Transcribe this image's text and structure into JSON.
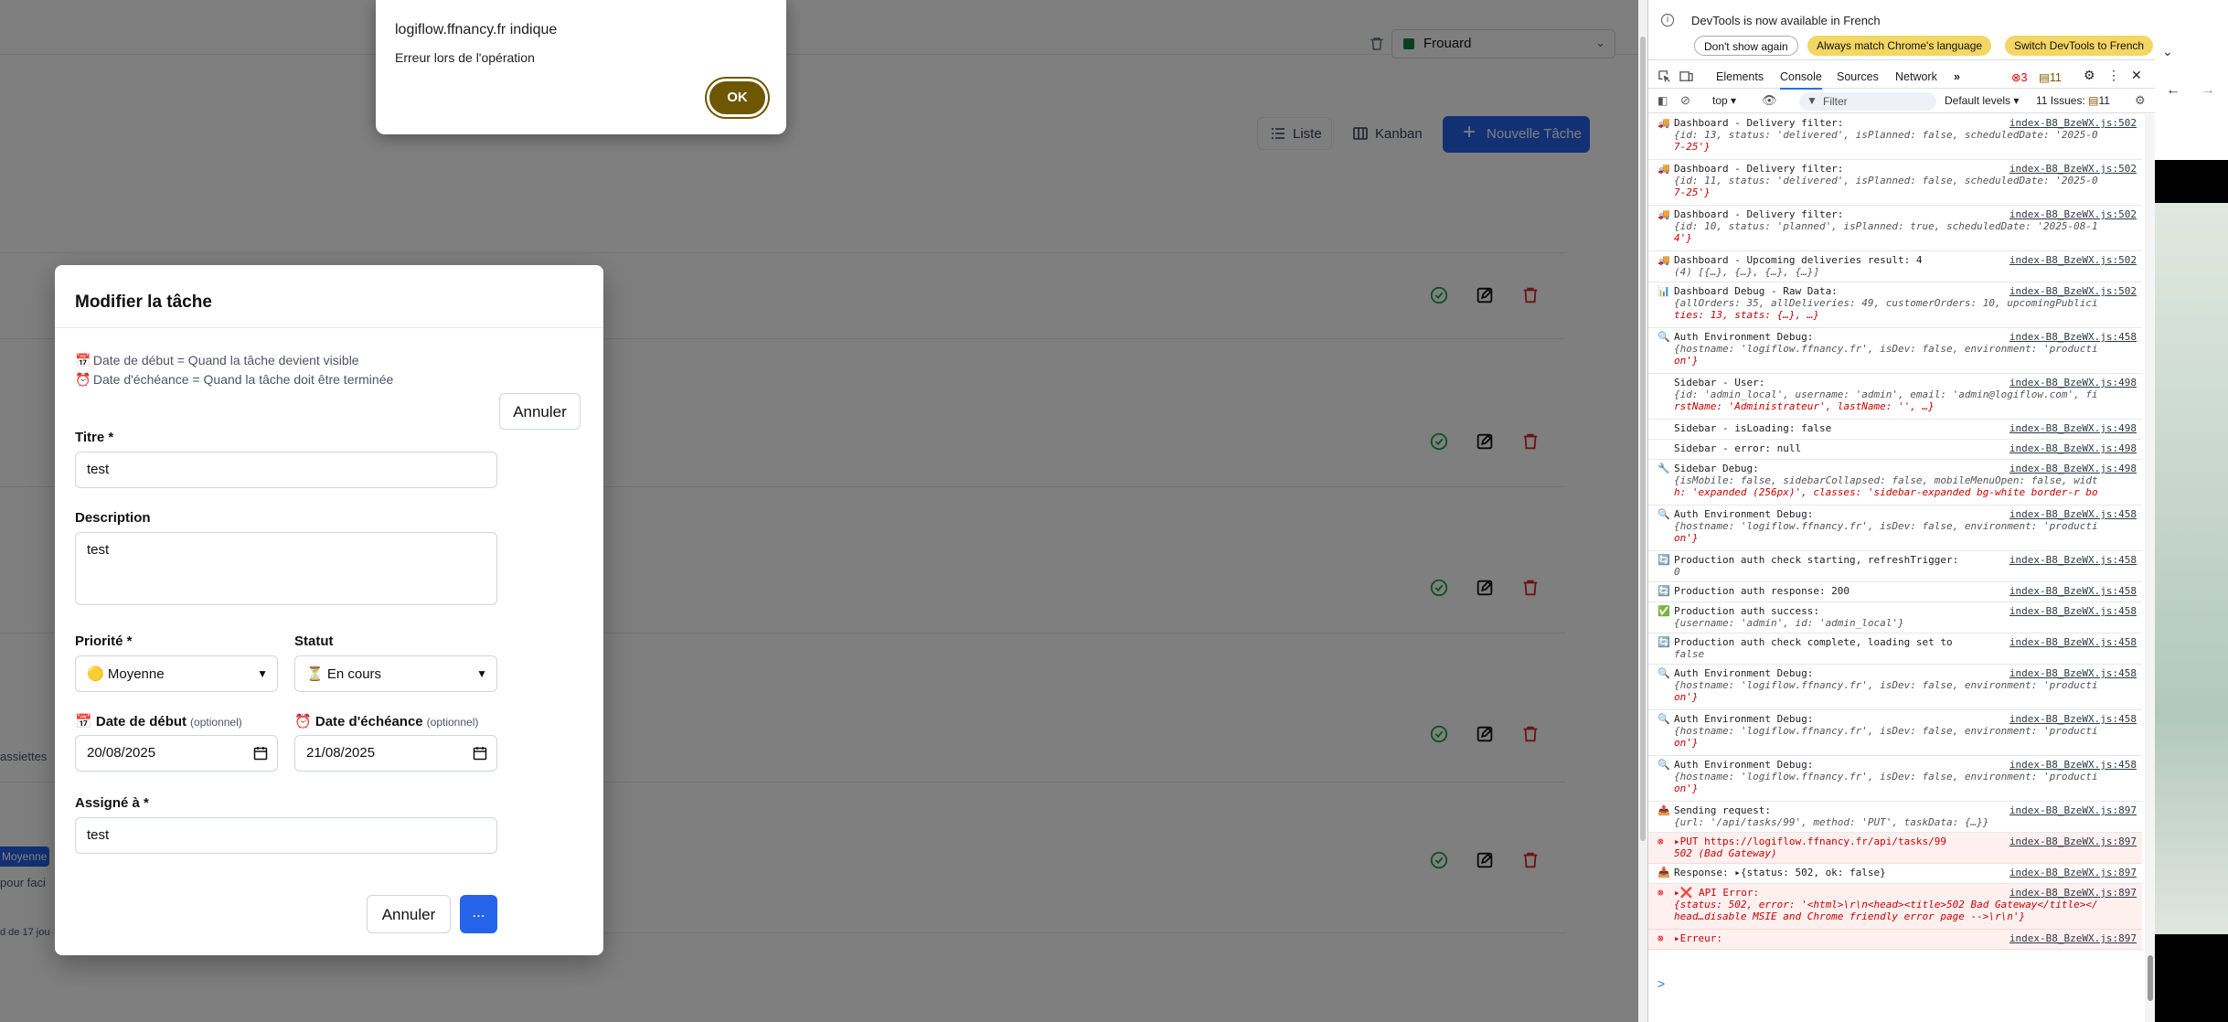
{
  "app": {
    "user_select_value": "Frouard",
    "view_list_label": "Liste",
    "view_kanban_label": "Kanban",
    "new_task_label": "Nouvelle Tâche",
    "snippet_1": "assiettes",
    "snippet_badge": "Moyenne",
    "snippet_2": "pour faci",
    "snippet_3": "d de 17 jou"
  },
  "alert": {
    "title": "logiflow.ffnancy.fr indique",
    "message": "Erreur lors de l'opération",
    "ok_label": "OK"
  },
  "modal": {
    "title": "Modifier la tâche",
    "hint_start": "Date de début = Quand la tâche devient visible",
    "hint_due": "Date d'échéance = Quand la tâche doit être terminée",
    "cancel_top_label": "Annuler",
    "title_label": "Titre *",
    "title_value": "test",
    "description_label": "Description",
    "description_value": "test",
    "priority_label": "Priorité *",
    "priority_value": "Moyenne",
    "status_label": "Statut",
    "status_value": "En cours",
    "start_label": "Date de début",
    "start_optional": "(optionnel)",
    "start_value": "20/08/2025",
    "due_label": "Date d'échéance",
    "due_optional": "(optionnel)",
    "due_value": "21/08/2025",
    "assigned_label": "Assigné à *",
    "assigned_value": "test",
    "cancel_label": "Annuler",
    "save_label": "..."
  },
  "devtools": {
    "info_text": "DevTools is now available in French",
    "btn_dont_show": "Don't show again",
    "btn_match": "Always match Chrome's language",
    "btn_switch": "Switch DevTools to French",
    "tabs": [
      "Elements",
      "Console",
      "Sources",
      "Network"
    ],
    "error_count": "3",
    "warn_count": "11",
    "context": "top",
    "filter_placeholder": "Filter",
    "levels": "Default levels",
    "issues": "11 Issues:",
    "issues_count": "11",
    "logs": [
      {
        "icon": "🚚",
        "msg": "Dashboard - Delivery filter:",
        "src": "index-B8_BzeWX.js:502",
        "sub": "{id: 13, status: 'delivered', isPlanned: false, scheduledDate: '2025-0",
        "sub2": "7-25'}"
      },
      {
        "icon": "🚚",
        "msg": "Dashboard - Delivery filter:",
        "src": "index-B8_BzeWX.js:502",
        "sub": "{id: 11, status: 'delivered', isPlanned: false, scheduledDate: '2025-0",
        "sub2": "7-25'}"
      },
      {
        "icon": "🚚",
        "msg": "Dashboard - Delivery filter:",
        "src": "index-B8_BzeWX.js:502",
        "sub": "{id: 10, status: 'planned', isPlanned: true, scheduledDate: '2025-08-1",
        "sub2": "4'}"
      },
      {
        "icon": "🚚",
        "msg": "Dashboard - Upcoming deliveries result: 4",
        "src": "index-B8_BzeWX.js:502",
        "sub": "(4) [{…}, {…}, {…}, {…}]",
        "sub2": ""
      },
      {
        "icon": "📊",
        "msg": "Dashboard Debug - Raw Data:",
        "src": "index-B8_BzeWX.js:502",
        "sub": "{allOrders: 35, allDeliveries: 49, customerOrders: 10, upcomingPublici",
        "sub2": "ties: 13, stats: {…}, …}"
      },
      {
        "icon": "🔍",
        "msg": "Auth Environment Debug:",
        "src": "index-B8_BzeWX.js:458",
        "sub": "{hostname: 'logiflow.ffnancy.fr', isDev: false, environment: 'producti",
        "sub2": "on'}"
      },
      {
        "icon": "",
        "msg": "Sidebar - User:",
        "src": "index-B8_BzeWX.js:498",
        "sub": "{id: 'admin_local', username: 'admin', email: 'admin@logiflow.com', fi",
        "sub2": "rstName: 'Administrateur', lastName: '', …}"
      },
      {
        "icon": "",
        "msg": "Sidebar - isLoading: false",
        "src": "index-B8_BzeWX.js:498",
        "sub": "",
        "sub2": ""
      },
      {
        "icon": "",
        "msg": "Sidebar - error: null",
        "src": "index-B8_BzeWX.js:498",
        "sub": "",
        "sub2": ""
      },
      {
        "icon": "🔧",
        "msg": "Sidebar Debug:",
        "src": "index-B8_BzeWX.js:498",
        "sub": "{isMobile: false, sidebarCollapsed: false, mobileMenuOpen: false, widt",
        "sub2": "h: 'expanded (256px)', classes: 'sidebar-expanded bg-white border-r bo"
      },
      {
        "icon": "🔍",
        "msg": "Auth Environment Debug:",
        "src": "index-B8_BzeWX.js:458",
        "sub": "{hostname: 'logiflow.ffnancy.fr', isDev: false, environment: 'producti",
        "sub2": "on'}"
      },
      {
        "icon": "🔄",
        "msg": "Production auth check starting, refreshTrigger:",
        "src": "index-B8_BzeWX.js:458",
        "sub": "0",
        "sub2": ""
      },
      {
        "icon": "🔄",
        "msg": "Production auth response: 200",
        "src": "index-B8_BzeWX.js:458",
        "sub": "",
        "sub2": ""
      },
      {
        "icon": "✅",
        "msg": "Production auth success:",
        "src": "index-B8_BzeWX.js:458",
        "sub": "{username: 'admin', id: 'admin_local'}",
        "sub2": ""
      },
      {
        "icon": "🔄",
        "msg": "Production auth check complete, loading set to",
        "src": "index-B8_BzeWX.js:458",
        "sub": "false",
        "sub2": ""
      },
      {
        "icon": "🔍",
        "msg": "Auth Environment Debug:",
        "src": "index-B8_BzeWX.js:458",
        "sub": "{hostname: 'logiflow.ffnancy.fr', isDev: false, environment: 'producti",
        "sub2": "on'}"
      },
      {
        "icon": "🔍",
        "msg": "Auth Environment Debug:",
        "src": "index-B8_BzeWX.js:458",
        "sub": "{hostname: 'logiflow.ffnancy.fr', isDev: false, environment: 'producti",
        "sub2": "on'}"
      },
      {
        "icon": "🔍",
        "msg": "Auth Environment Debug:",
        "src": "index-B8_BzeWX.js:458",
        "sub": "{hostname: 'logiflow.ffnancy.fr', isDev: false, environment: 'producti",
        "sub2": "on'}"
      },
      {
        "icon": "📤",
        "msg": "Sending request:",
        "src": "index-B8_BzeWX.js:897",
        "sub": "{url: '/api/tasks/99', method: 'PUT', taskData: {…}}",
        "sub2": ""
      },
      {
        "icon": "⊗",
        "msg": "▸PUT https://logiflow.ffnancy.fr/api/tasks/99",
        "src": "index-B8_BzeWX.js:897",
        "sub": "502 (Bad Gateway)",
        "sub2": "",
        "err": true
      },
      {
        "icon": "📥",
        "msg": "Response:  ▸{status: 502, ok: false}",
        "src": "index-B8_BzeWX.js:897",
        "sub": "",
        "sub2": ""
      },
      {
        "icon": "⊗",
        "msg": "▸❌ API Error:",
        "src": "index-B8_BzeWX.js:897",
        "sub": "{status: 502, error: '<html>\\r\\n<head><title>502 Bad Gateway</title></",
        "sub2": "head…disable MSIE and Chrome friendly error page -->\\r\\n'}",
        "err": true
      },
      {
        "icon": "⊗",
        "msg": "▸Erreur:",
        "src": "index-B8_BzeWX.js:897",
        "sub": "",
        "sub2": "",
        "err": true
      }
    ],
    "prompt": ">"
  },
  "colors": {
    "accent": "#2563eb",
    "alert_ok": "#6d5703",
    "devtools_blue": "#1a73e8"
  }
}
